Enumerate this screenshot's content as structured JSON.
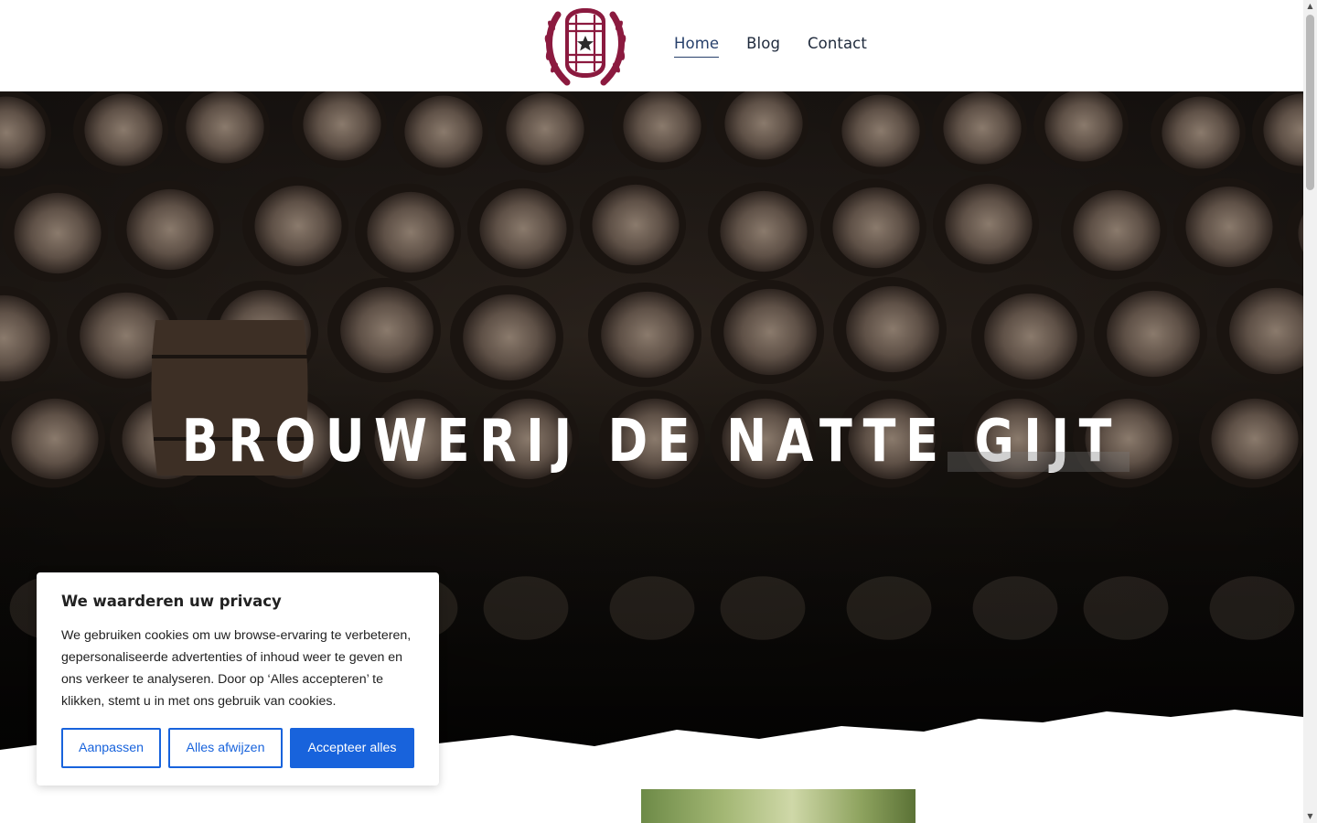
{
  "header": {
    "logo_alt": "Brouwerij De Natte Gijt",
    "nav": [
      {
        "label": "Home",
        "active": true
      },
      {
        "label": "Blog",
        "active": false
      },
      {
        "label": "Contact",
        "active": false
      }
    ]
  },
  "hero": {
    "title": "BROUWERIJ DE NATTE GIJT"
  },
  "cookie_banner": {
    "title": "We waarderen uw privacy",
    "text": "We gebruiken cookies om uw browse-ervaring te verbeteren, gepersonaliseerde advertenties of inhoud weer te geven en ons verkeer te analyseren. Door op ‘Alles accepteren’ te klikken, stemt u in met ons gebruik van cookies.",
    "customize_label": "Aanpassen",
    "reject_label": "Alles afwijzen",
    "accept_label": "Accepteer alles"
  },
  "colors": {
    "brand": "#8b1a3f",
    "nav_active": "#27406b",
    "cookie_button": "#1863dc"
  },
  "icons": {
    "logo": "barrel-wheat-crest-icon",
    "scroll_up": "triangle-up-icon",
    "scroll_down": "triangle-down-icon"
  }
}
